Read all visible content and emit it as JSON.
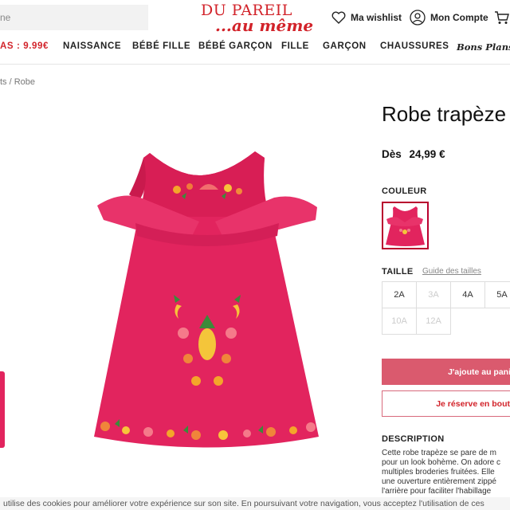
{
  "header": {
    "search_placeholder_fragment": "ne",
    "logo_line1": "DU PAREIL",
    "logo_line2": "...au même",
    "wishlist": "Ma wishlist",
    "account": "Mon Compte",
    "icons": {
      "wishlist": "heart-icon",
      "account": "user-icon",
      "cart": "cart-icon"
    }
  },
  "nav": {
    "items": [
      "AS : 9.99€",
      "NAISSANCE",
      "BÉBÉ FILLE",
      "BÉBÉ GARÇON",
      "FILLE",
      "GARÇON",
      "CHAUSSURES",
      "Bons Plans D"
    ]
  },
  "breadcrumb": "ts / Robe",
  "product": {
    "title": "Robe trapèze",
    "price_prefix": "Dès",
    "price": "24,99 €",
    "color_label": "COULEUR",
    "size_label": "TAILLE",
    "size_guide": "Guide des tailles",
    "sizes": [
      {
        "label": "2A",
        "available": true
      },
      {
        "label": "3A",
        "available": false
      },
      {
        "label": "4A",
        "available": true
      },
      {
        "label": "5A",
        "available": true
      },
      {
        "label": "10A",
        "available": false
      },
      {
        "label": "12A",
        "available": false
      }
    ],
    "add_button": "J'ajoute au pani",
    "reserve_button": "Je réserve en bout",
    "description_title": "DESCRIPTION",
    "description_lines": [
      "Cette robe trapèze se pare de m",
      "pour un look bohème. On adore c",
      "multiples broderies fruitées. Elle",
      "une ouverture entièrement zippé",
      "l'arrière pour faciliter l'habillage"
    ]
  },
  "cookie_text": "utilise des cookies pour améliorer votre expérience sur son site. En poursuivant votre navigation, vous acceptez l'utilisation de ces",
  "colors": {
    "brand_red": "#d2232a",
    "dress": "#e2245e",
    "button": "#da5a6e"
  }
}
